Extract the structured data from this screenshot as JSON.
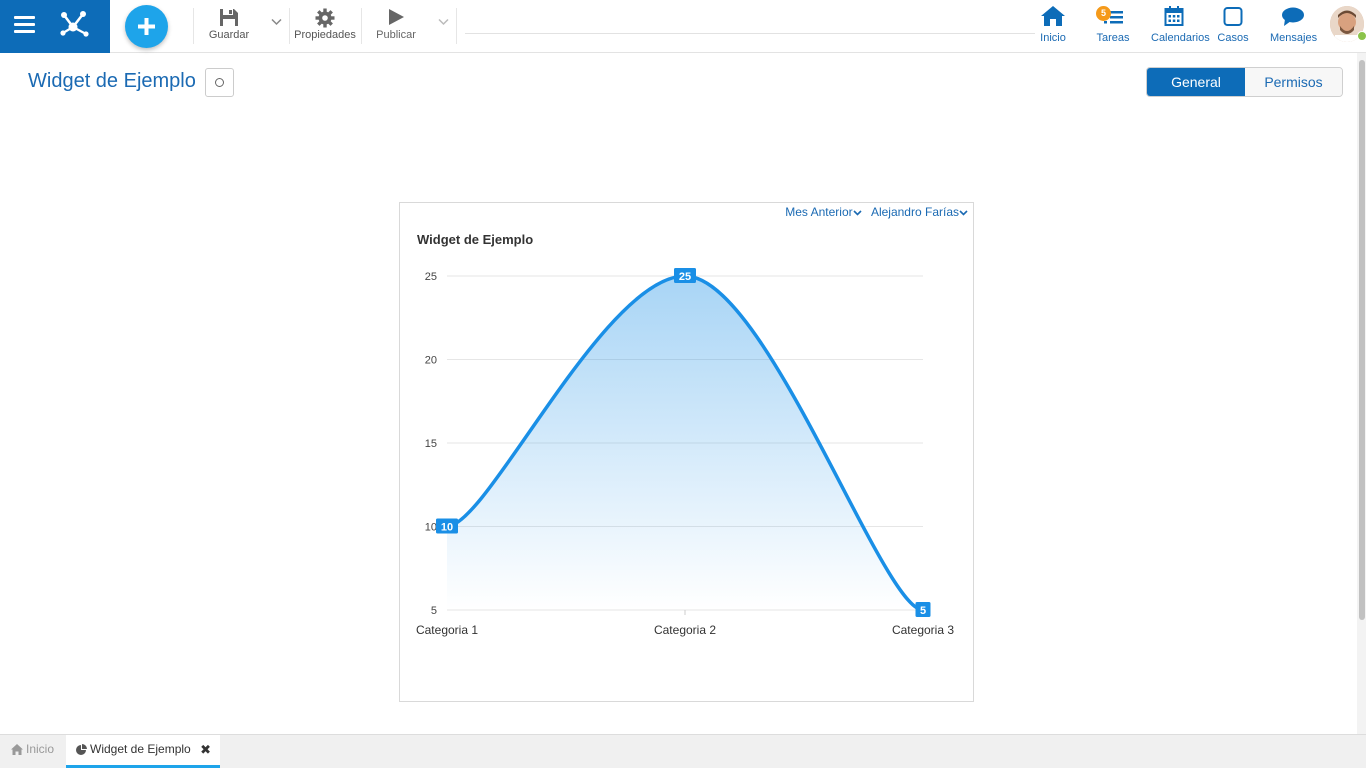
{
  "toolbar": {
    "save_label": "Guardar",
    "properties_label": "Propiedades",
    "publish_label": "Publicar"
  },
  "nav": {
    "items": [
      {
        "label": "Inicio",
        "icon": "home-icon"
      },
      {
        "label": "Tareas",
        "icon": "tasks-icon",
        "badge": "5"
      },
      {
        "label": "Calendarios",
        "icon": "calendar-icon"
      },
      {
        "label": "Casos",
        "icon": "case-icon"
      },
      {
        "label": "Mensajes",
        "icon": "message-icon"
      }
    ]
  },
  "page": {
    "title": "Widget de Ejemplo",
    "tabs": [
      {
        "label": "General",
        "active": true
      },
      {
        "label": "Permisos",
        "active": false
      }
    ]
  },
  "widget": {
    "filters": [
      {
        "label": "Mes Anterior"
      },
      {
        "label": "Alejandro Farías"
      }
    ]
  },
  "chart_data": {
    "type": "area",
    "title": "Widget de Ejemplo",
    "categories": [
      "Categoria 1",
      "Categoria 2",
      "Categoria 3"
    ],
    "values": [
      10,
      25,
      5
    ],
    "data_labels": [
      "10",
      "25",
      "5"
    ],
    "y_ticks": [
      "5",
      "10",
      "15",
      "20",
      "25"
    ],
    "ylim": [
      5,
      25
    ],
    "grid": true,
    "smooth": true,
    "color": "#1a8fe6"
  },
  "bottom_tabs": [
    {
      "label": "Inicio",
      "active": false
    },
    {
      "label": "Widget de Ejemplo",
      "active": true
    }
  ],
  "colors": {
    "brand": "#0d6cb8",
    "accent": "#1ea4ea",
    "badge": "#f59a1a",
    "nav_text": "#1b6ab3"
  }
}
